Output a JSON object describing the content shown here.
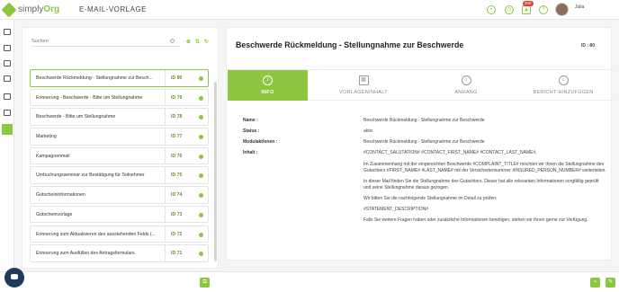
{
  "app": {
    "logo_prefix": "simply",
    "logo_suffix": "Org",
    "title": "E-MAIL-VORLAGE"
  },
  "user": {
    "name": "Julia",
    "notification_count": "200"
  },
  "search": {
    "placeholder": "Suchen"
  },
  "templates": [
    {
      "name": "Beschwerde Rückmeldung - Stellungnahme zur Besch...",
      "id": "ID 80",
      "selected": true
    },
    {
      "name": "Erinnerung - Beschwerde - Bitte um Stellungnahme",
      "id": "ID 79"
    },
    {
      "name": "Beschwerde - Bitte um Stellungnahme",
      "id": "ID 78"
    },
    {
      "name": "Marketing",
      "id": "ID 77"
    },
    {
      "name": "Kampagnenmail",
      "id": "ID 76"
    },
    {
      "name": "Umbuchungsseminar zur Bestätigung für Teilnehmer",
      "id": "ID 75"
    },
    {
      "name": "Gutscheininformationen",
      "id": "ID 74"
    },
    {
      "name": "Gutscheinvorlage",
      "id": "ID 73"
    },
    {
      "name": "Erinnerung zum Aktualisieren des ausstehenden Felds (...",
      "id": "ID 72"
    },
    {
      "name": "Erinnerung zum Ausfüllen des Antragsformulars",
      "id": "ID 71"
    }
  ],
  "detail": {
    "title": "Beschwerde Rückmeldung - Stellungnahme zur Beschwerde",
    "id_label": "ID : 80",
    "tabs": [
      {
        "label": "INFO",
        "active": true
      },
      {
        "label": "VORLAGENINHALT"
      },
      {
        "label": "ANHANG"
      },
      {
        "label": "BERICHT HINZUFÜGEN"
      }
    ],
    "fields": {
      "name_label": "Name :",
      "name_value": "Beschwerde Rückmeldung - Stellungnahme zur Beschwerde",
      "status_label": "Status :",
      "status_value": "aktiv",
      "modul_label": "Modulaktionen :",
      "modul_value": "Beschwerde Rückmeldung - Stellungnahme zur Beschwerde",
      "inhalt_label": "Inhalt :",
      "inhalt_p1": "#CONTACT_SALUTATION# #CONTACT_FIRST_NAME# #CONTACT_LAST_NAME#,",
      "inhalt_p2": "Im Zusammenhang mit der eingereichten Beschwerde #COMPLAINT_TITLE# möchten wir Ihnen die Stellungnahme des Gutachters #FIRST_NAME# #LAST_NAME# mit der Versichertennummer #INSURED_PERSON_NUMBER# weiterleiten.",
      "inhalt_p3": "In dieser Mail finden Sie die Stellungnahme des Gutachters. Dieser hat alle relevanten Informationen sorgfältig geprüft und seine Stellungnahme daraus gezogen.",
      "inhalt_p4": "Wir bitten Sie die nachfolgende Stellungnahme im Detail zu prüfen:",
      "inhalt_p5": "#STATEMENT_DESCRIPTION#",
      "inhalt_p6": "Falls Sie weitere Fragen haben oder zusätzliche Informationen benötigen, stehen wir Ihnen gerne zur Verfügung."
    }
  },
  "colors": {
    "accent": "#8dc63f",
    "chat": "#1f3a5f",
    "badge": "#e53935"
  }
}
